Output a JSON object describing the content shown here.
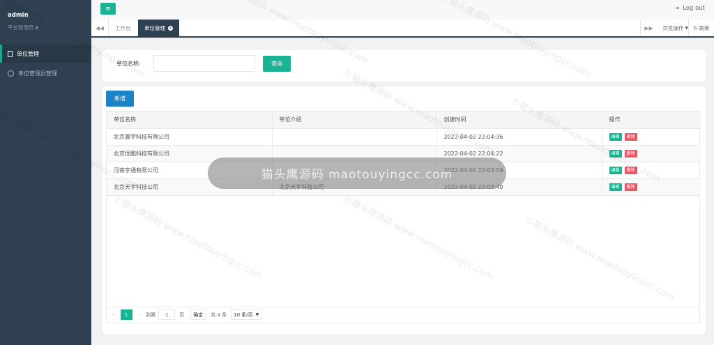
{
  "sidebar": {
    "user_name": "admin",
    "user_role": "平台管理员",
    "items": [
      {
        "label": "单位管理",
        "active": true,
        "icon": "document-icon"
      },
      {
        "label": "单位管理员管理",
        "active": false,
        "icon": "user-circle-icon"
      }
    ]
  },
  "topbar": {
    "menu_icon": "≡",
    "logout_label": "Log out"
  },
  "tabs": {
    "items": [
      {
        "label": "工作台",
        "active": false
      },
      {
        "label": "单位管理",
        "active": true
      }
    ],
    "ops_label": "页签操作",
    "refresh_label": "刷新"
  },
  "search": {
    "label": "单位名称:",
    "value": "",
    "button_label": "查询"
  },
  "table": {
    "add_label": "新增",
    "columns": [
      "单位名称",
      "单位介绍",
      "创建时间",
      "操作"
    ],
    "rows": [
      {
        "name": "北京寰宇科技有限公司",
        "intro": "",
        "created": "2022-04-02 22:04:36"
      },
      {
        "name": "北京优酷科技有限公司",
        "intro": "",
        "created": "2022-04-02 22:04:22"
      },
      {
        "name": "河南宇通有限公司",
        "intro": "",
        "created": "2022-04-02 22:03:59"
      },
      {
        "name": "北京天宇科技公司",
        "intro": "北京天宇科技公司",
        "created": "2022-04-02 22:03:40"
      }
    ],
    "edit_label": "编辑",
    "delete_label": "删除"
  },
  "pagination": {
    "current_page": "1",
    "goto_prefix": "到第",
    "goto_value": "1",
    "goto_suffix": "页",
    "confirm_label": "确定",
    "total_label": "共 4 条",
    "page_size": "10 条/页"
  },
  "watermark": {
    "band_text": "猫头鹰源码 maotouyingcc.com",
    "tile_text": "©猫头鹰源码 www.maotouyingcc.com"
  },
  "colors": {
    "sidebar": "#2f4050",
    "primary": "#1ab394",
    "blue": "#1c84c6",
    "danger": "#ed5565"
  }
}
